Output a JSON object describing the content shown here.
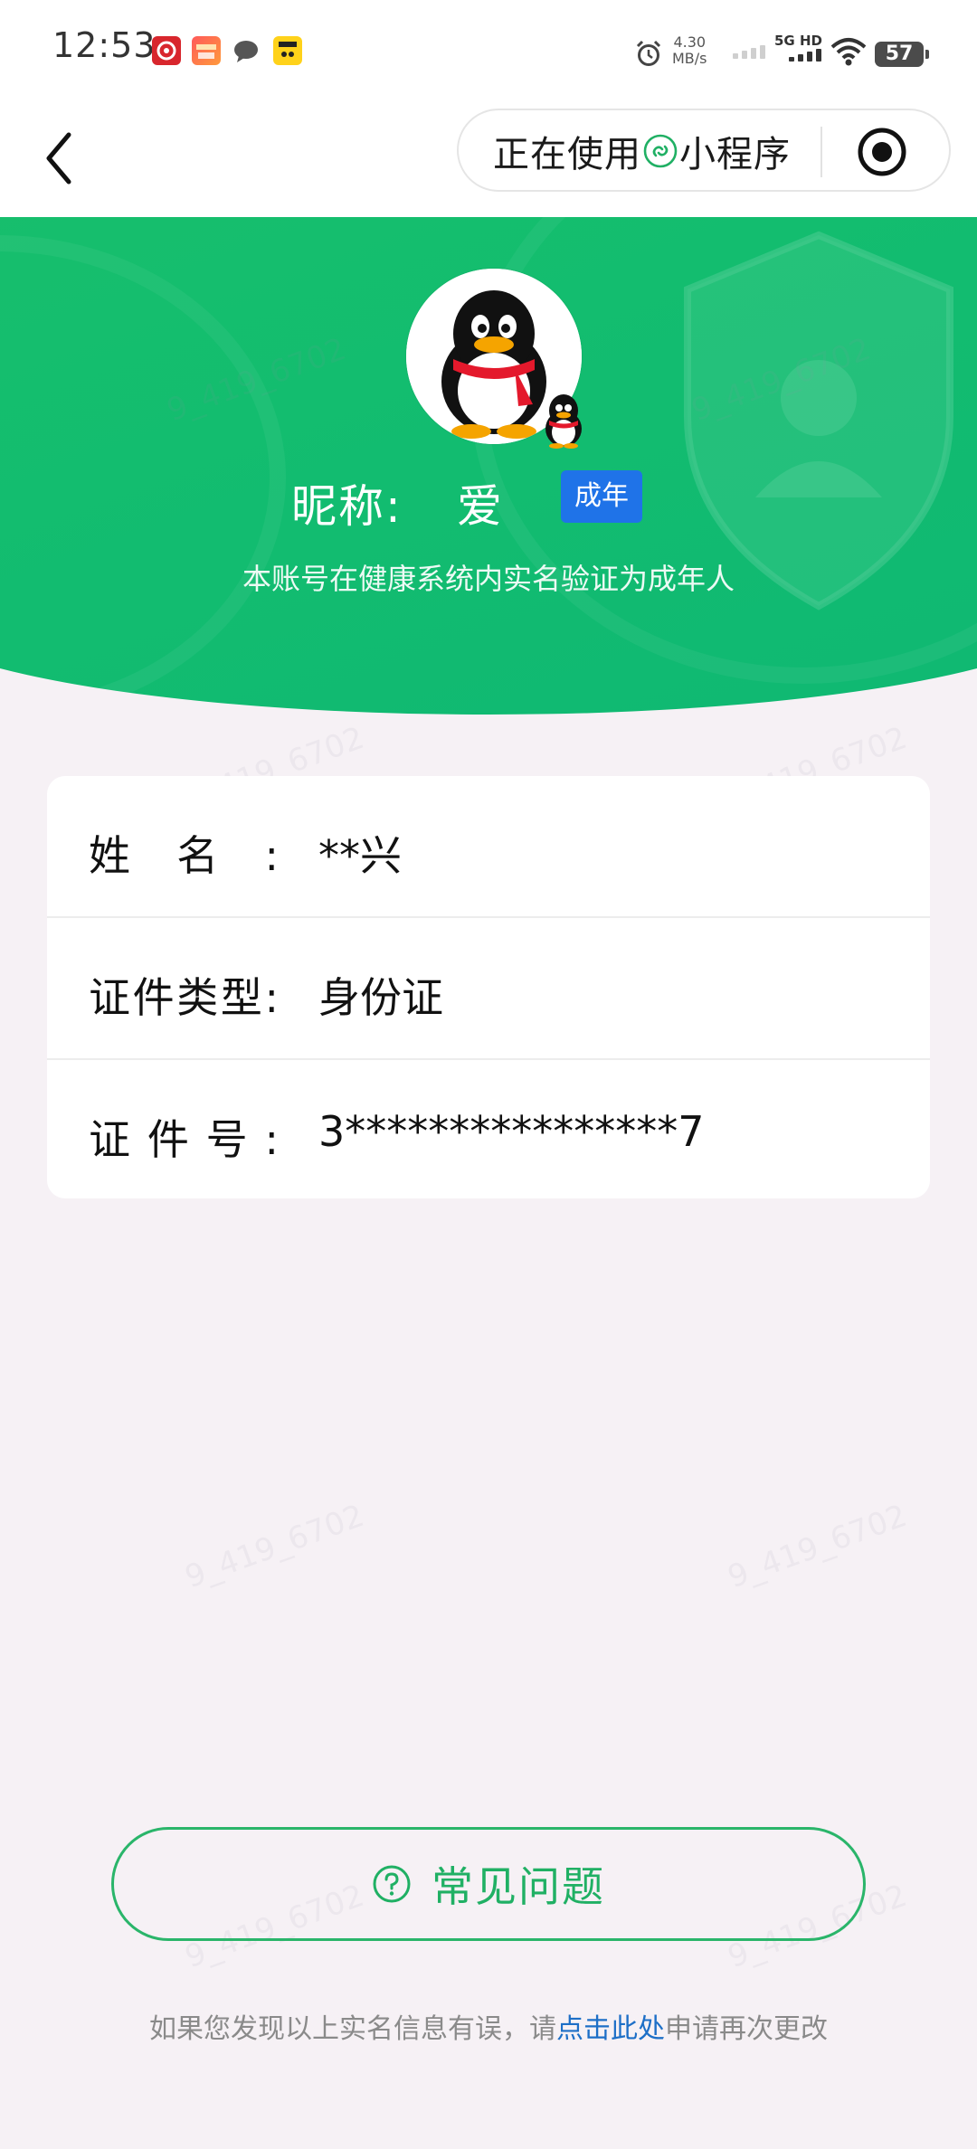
{
  "status_bar": {
    "time": "12:53",
    "net_speed_value": "4.30",
    "net_speed_unit": "MB/s",
    "network_tag": "5G HD",
    "battery": "57"
  },
  "nav": {
    "capsule_prefix": "正在使用",
    "capsule_suffix": "小程序"
  },
  "header": {
    "nickname_label": "昵称:",
    "nickname_value": "爱",
    "adult_badge": "成年",
    "description": "本账号在健康系统内实名验证为成年人"
  },
  "info": {
    "rows": [
      {
        "label": "姓名:",
        "value": "**兴"
      },
      {
        "label": "证件类型:",
        "value": "身份证"
      },
      {
        "label": "证件号:",
        "value": "3****************7"
      }
    ]
  },
  "faq_button": {
    "label": "常见问题"
  },
  "footer": {
    "before_link": "如果您发现以上实名信息有误，请",
    "link": "点击此处",
    "after_link": "申请再次更改"
  },
  "watermark_text": "9_419_6702",
  "colors": {
    "brand_green": "#13bd6f",
    "badge_blue": "#1f73e8",
    "link_blue": "#1d6fc7"
  }
}
